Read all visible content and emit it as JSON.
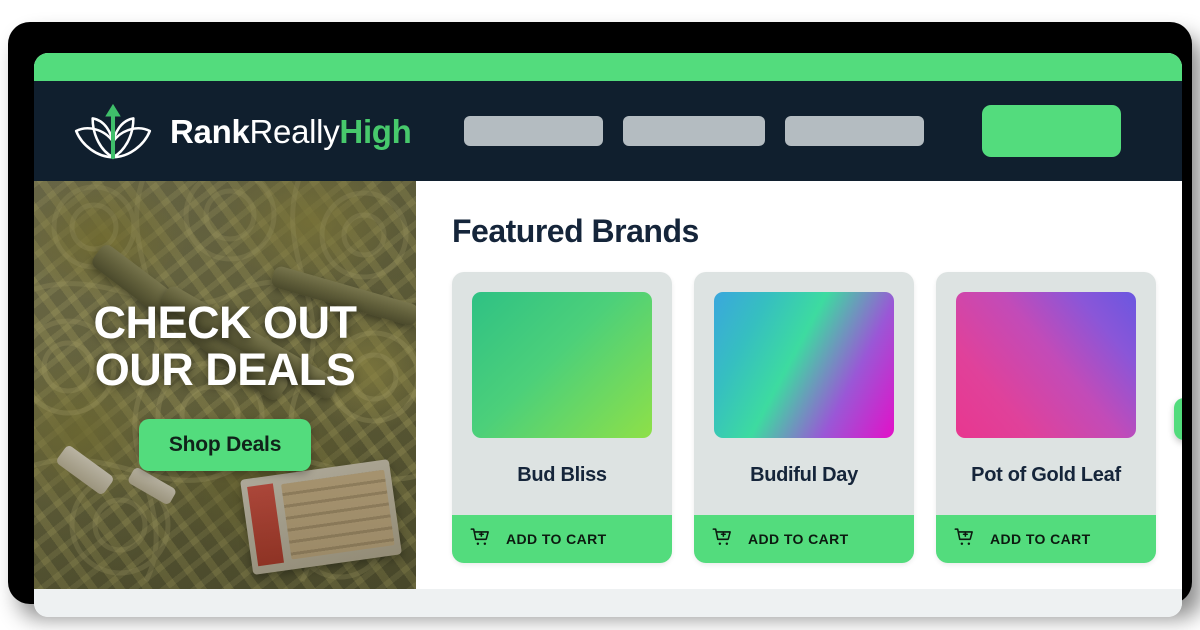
{
  "brand": {
    "logo_icon": "cannabis-leaf-arrow-icon",
    "name_part1": "Rank",
    "name_part2": "Really",
    "name_part3": "High"
  },
  "colors": {
    "accent_green": "#53dc7d",
    "navbar_dark": "#101f2e",
    "heading_navy": "#15253a",
    "nav_placeholder_gray": "#b4bcc1",
    "card_bg": "#dde3e2",
    "footer_strip": "#eef1f2"
  },
  "navbar": {
    "links": [
      {
        "label": "",
        "placeholder": true
      },
      {
        "label": "",
        "placeholder": true
      },
      {
        "label": "",
        "placeholder": true
      }
    ],
    "cta": {
      "label": "",
      "placeholder": true
    }
  },
  "hero": {
    "title": "CHECK OUT\nOUR DEALS",
    "button_label": "Shop Deals",
    "image_alt": "pre-rolled joints and matchbox on ornate olive-gold patterned tile"
  },
  "featured": {
    "title": "Featured Brands",
    "next_icon": "arrow-right-icon",
    "cards": [
      {
        "name": "Bud Bliss",
        "cta_label": "ADD TO CART",
        "cart_icon": "cart-plus-icon",
        "thumb_gradient": "green"
      },
      {
        "name": "Budiful Day",
        "cta_label": "ADD TO CART",
        "cart_icon": "cart-plus-icon",
        "thumb_gradient": "blue-magenta"
      },
      {
        "name": "Pot of Gold Leaf",
        "cta_label": "ADD TO CART",
        "cart_icon": "cart-plus-icon",
        "thumb_gradient": "pink-purple"
      }
    ]
  }
}
